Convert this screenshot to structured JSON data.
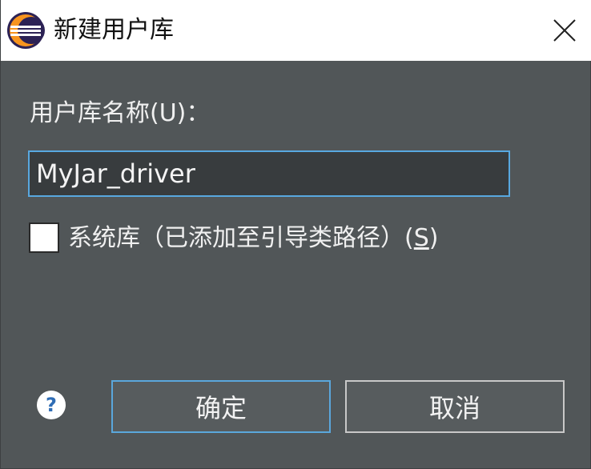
{
  "window": {
    "title": "新建用户库",
    "close_icon": "close-icon",
    "app_icon": "eclipse-logo-icon"
  },
  "form": {
    "name_label": "用户库名称(U)：",
    "name_value": "MyJar_driver",
    "system_library_checkbox": {
      "checked": false,
      "label_prefix": "系统库（已添加至引导类路径）(",
      "mnemonic": "S",
      "label_suffix": ")"
    }
  },
  "footer": {
    "help_icon": "help-question-icon",
    "ok_label": "确定",
    "cancel_label": "取消"
  },
  "colors": {
    "background": "#515658",
    "titlebar": "#ffffff",
    "focus_accent": "#58a8e0",
    "text": "#f0f0f0"
  }
}
